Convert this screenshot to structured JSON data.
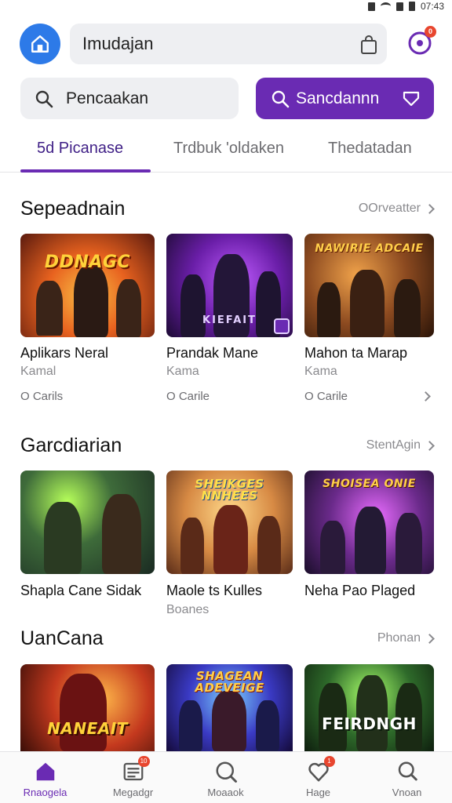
{
  "status_bar": {
    "time": "07:43"
  },
  "header": {
    "address_text": "Imudajan",
    "notification_badge": "0"
  },
  "search": {
    "input_placeholder": "Pencaakan",
    "button_label": "Sancdannn"
  },
  "tabs": [
    {
      "label": "5d Picanase",
      "active": true
    },
    {
      "label": "Trdbuk 'oldaken",
      "active": false
    },
    {
      "label": "Thedatadan",
      "active": false
    }
  ],
  "sections": [
    {
      "title": "Sepeadnain",
      "see_all": "OOrveatter",
      "cards": [
        {
          "thumb_title": "DDNAGC",
          "name": "Aplikars Neral",
          "sub": "Kamal",
          "meta": "O Carils"
        },
        {
          "thumb_title": "KIEFAIT",
          "name": "Prandak Mane",
          "sub": "Kama",
          "meta": "O Carile"
        },
        {
          "thumb_title": "NAWIRIE ADCAIE",
          "name": "Mahon ta Marap",
          "sub": "Kama",
          "meta": "O Carile"
        }
      ]
    },
    {
      "title": "Garcdiarian",
      "see_all": "StentAgin",
      "cards": [
        {
          "thumb_title": "",
          "name": "Shapla Cane Sidak",
          "sub": "",
          "meta": ""
        },
        {
          "thumb_title": "SHEIKGES NNHEES",
          "name": "Maole ts Kulles",
          "sub": "Boanes",
          "meta": ""
        },
        {
          "thumb_title": "SHOISEA ONIE",
          "name": "Neha Pao Plaged",
          "sub": "",
          "meta": ""
        }
      ]
    },
    {
      "title": "UanCana",
      "see_all": "Phonan",
      "cards": [
        {
          "thumb_title": "NANEAIT",
          "name": "",
          "sub": "",
          "meta": ""
        },
        {
          "thumb_title": "SHAGEAN ADEVEIGE",
          "name": "",
          "sub": "",
          "meta": ""
        },
        {
          "thumb_title": "FEIRDNGH",
          "name": "",
          "sub": "",
          "meta": ""
        }
      ]
    }
  ],
  "bottom_nav": [
    {
      "label": "Rnaogela",
      "icon": "home-icon",
      "active": true,
      "badge": ""
    },
    {
      "label": "Megadgr",
      "icon": "list-icon",
      "active": false,
      "badge": "10"
    },
    {
      "label": "Moaaok",
      "icon": "search-icon",
      "active": false,
      "badge": ""
    },
    {
      "label": "Hage",
      "icon": "heart-icon",
      "active": false,
      "badge": "1"
    },
    {
      "label": "Vnoan",
      "icon": "search-icon",
      "active": false,
      "badge": ""
    }
  ],
  "colors": {
    "accent": "#6a2bb3",
    "home_button": "#2d7ae8",
    "badge": "#e8462f"
  }
}
